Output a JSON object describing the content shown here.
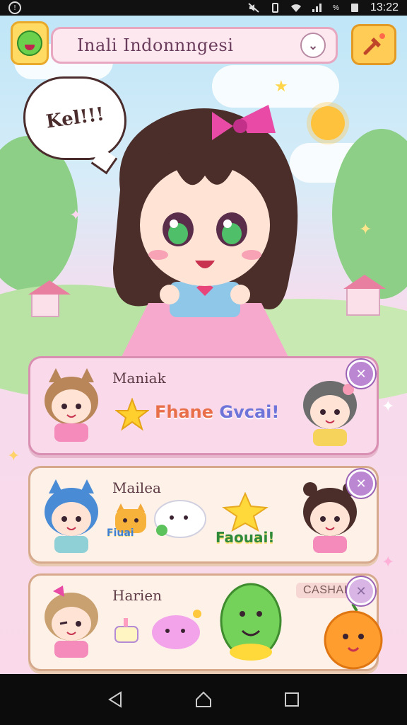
{
  "status_bar": {
    "time": "13:22",
    "battery_label": "%"
  },
  "header": {
    "language_label": "Inali Indonnngesi"
  },
  "speech_bubble": {
    "text": "Kel!!!"
  },
  "cards": [
    {
      "name": "Maniak",
      "message_part1": "Fhane",
      "message_part2": "Gvcai!"
    },
    {
      "name": "Mailea",
      "message": "Faouai!",
      "sticker_label": "Fiuai"
    },
    {
      "name": "Harien",
      "badge": "CASHAI"
    }
  ],
  "colors": {
    "accent_pink": "#e7a7c0",
    "close_purple": "#bb86d2",
    "brand_yellow": "#ffcd56"
  },
  "icons": [
    "alert-icon",
    "mute-icon",
    "vibrate-icon",
    "wifi-icon",
    "signal-icon",
    "battery-icon",
    "chevron-down-icon",
    "tool-icon",
    "close-icon",
    "back-icon",
    "home-icon",
    "recents-icon"
  ]
}
